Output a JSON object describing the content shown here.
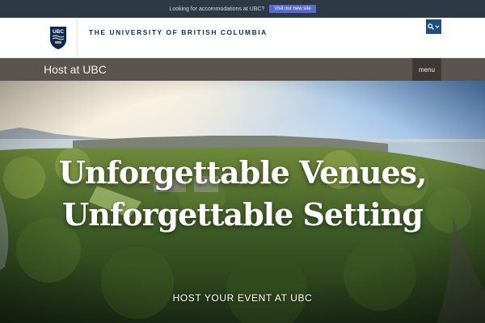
{
  "announcement": {
    "text": "Looking for accommodations at UBC?",
    "button_label": "Visit our new site"
  },
  "brand": {
    "crest_text": "UBC",
    "university_name": "THE UNIVERSITY OF BRITISH COLUMBIA",
    "search_icon": "search-icon",
    "dropdown_icon": "chevron-down-icon"
  },
  "site_nav": {
    "site_title": "Host at UBC",
    "menu_label": "menu"
  },
  "hero": {
    "title": "Unforgettable Venues, Unforgettable Setting",
    "subtitle": "HOST YOUR EVENT AT UBC"
  },
  "colors": {
    "announce_bg": "#2b3a44",
    "announce_button": "#5a6bd0",
    "ubc_navy": "#0b2b56",
    "search_blue": "#1d4e89",
    "site_bar": "#5a5450"
  }
}
